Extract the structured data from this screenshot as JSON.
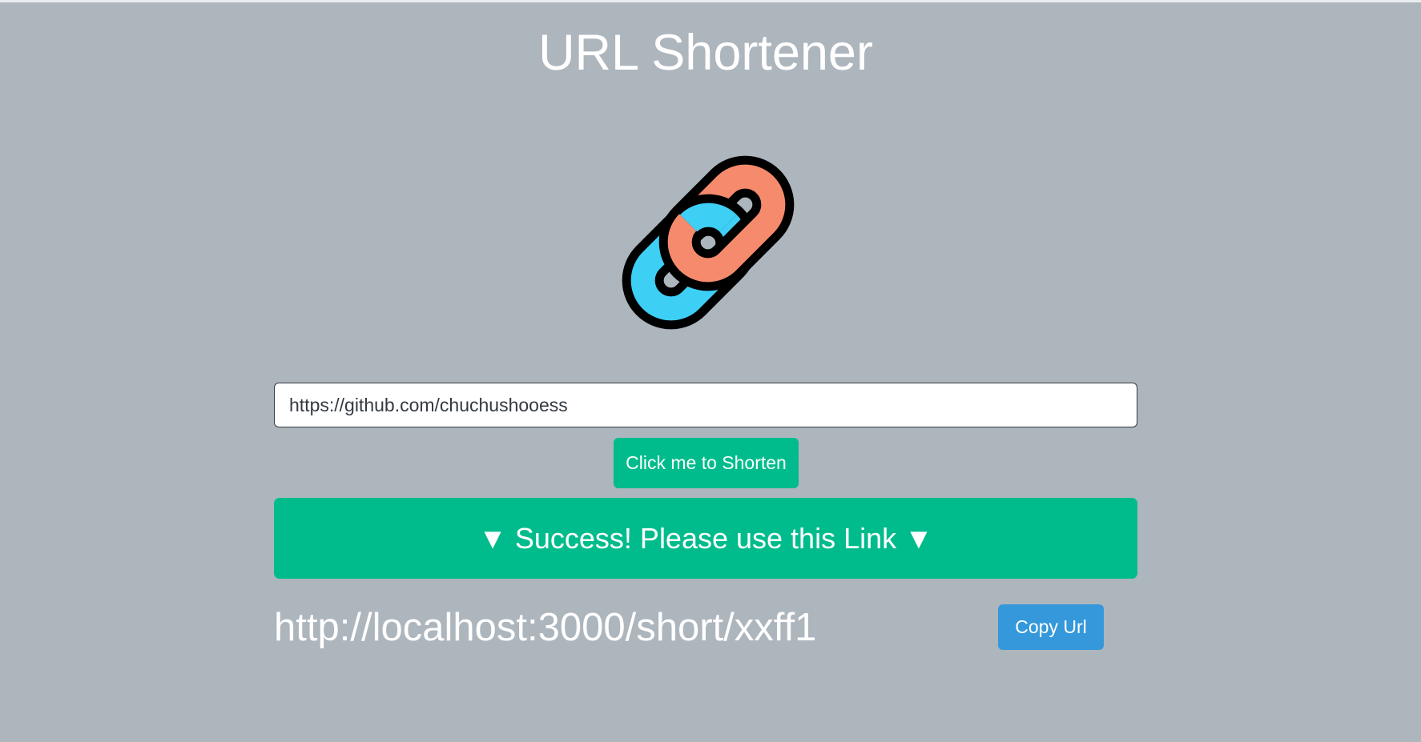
{
  "page": {
    "title": "URL Shortener",
    "logo_icon": "chain-link-icon",
    "colors": {
      "background": "#adb5bd",
      "success": "#00bc8c",
      "info": "#3498db",
      "link_orange": "#f58b6c",
      "link_blue": "#3ecff5"
    }
  },
  "form": {
    "url_value": "https://github.com/chuchushooess",
    "shorten_label": "Click me to Shorten"
  },
  "result": {
    "banner": "▼ Success! Please use this Link ▼",
    "short_url": "http://localhost:3000/short/xxff1",
    "copy_label": "Copy Url"
  }
}
